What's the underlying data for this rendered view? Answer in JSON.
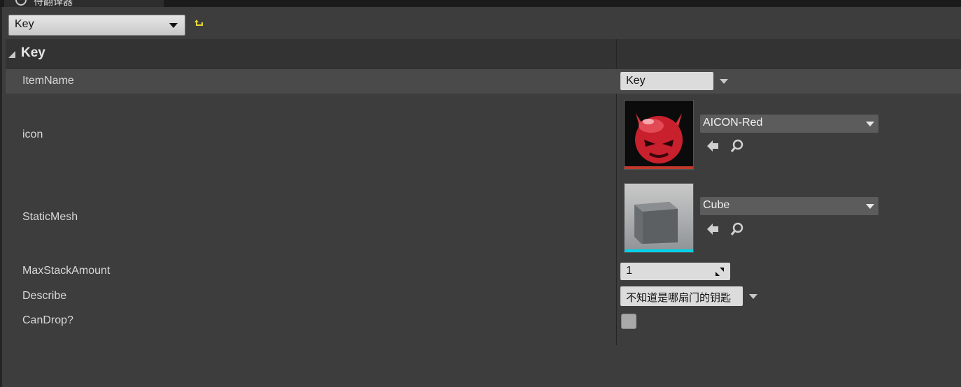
{
  "window": {
    "tab_title": "待翻译器"
  },
  "toolbar": {
    "selector_value": "Key"
  },
  "category": {
    "title": "Key"
  },
  "properties": {
    "item_name": {
      "label": "ItemName",
      "value": "Key"
    },
    "icon": {
      "label": "icon",
      "asset": "AICON-Red"
    },
    "static_mesh": {
      "label": "StaticMesh",
      "asset": "Cube"
    },
    "max_stack": {
      "label": "MaxStackAmount",
      "value": "1"
    },
    "describe": {
      "label": "Describe",
      "value": "不知道是哪扇门的钥匙"
    },
    "can_drop": {
      "label": "CanDrop?",
      "checked": false
    }
  },
  "colors": {
    "texture_accent": "#c0392b",
    "mesh_accent": "#00d0e8",
    "reset_icon": "#e6d63a"
  },
  "icons": [
    "search-icon",
    "reset-to-default-icon",
    "collapse-triangle-icon",
    "use-selected-arrow-icon",
    "browse-magnifier-icon",
    "spin-drag-icon"
  ]
}
